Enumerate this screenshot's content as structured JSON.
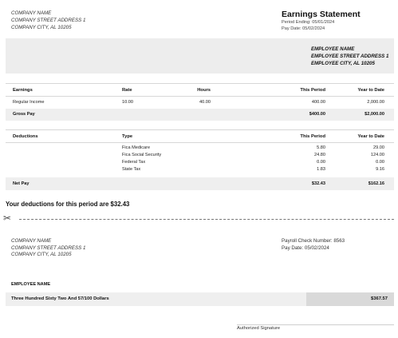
{
  "company": {
    "name": "COMPANY NAME",
    "address": "COMPANY STREET ADDRESS 1",
    "city": "COMPANY CITY, AL 10205"
  },
  "statement": {
    "title": "Earnings Statement",
    "period_ending": "Period Ending: 05/01/2024",
    "pay_date": "Pay Date: 05/02/2024"
  },
  "employee": {
    "name": "EMPLOYEE NAME",
    "address": "EMPLOYEE STREET ADDRESS 1",
    "city": "EMPLOYEE CITY, AL 10205"
  },
  "earnings": {
    "headers": {
      "label": "Earnings",
      "rate": "Rate",
      "hours": "Hours",
      "this_period": "This Period",
      "ytd": "Year to Date"
    },
    "rows": [
      {
        "label": "Regular Income",
        "rate": "10.00",
        "hours": "40.00",
        "this_period": "400.00",
        "ytd": "2,000.00"
      }
    ],
    "gross": {
      "label": "Gross Pay",
      "this_period": "$400.00",
      "ytd": "$2,000.00"
    }
  },
  "deductions": {
    "headers": {
      "label": "Deductions",
      "type": "Type",
      "this_period": "This Period",
      "ytd": "Year to Date"
    },
    "rows": [
      {
        "type": "Fica Medicare",
        "this_period": "5.80",
        "ytd": "29.00"
      },
      {
        "type": "Fica Social Security",
        "this_period": "24.80",
        "ytd": "124.00"
      },
      {
        "type": "Federal Tax",
        "this_period": "0.00",
        "ytd": "0.00"
      },
      {
        "type": "State Tax",
        "this_period": "1.83",
        "ytd": "9.16"
      }
    ],
    "net": {
      "label": "Net Pay",
      "this_period": "$32.43",
      "ytd": "$162.16"
    }
  },
  "note": "Your deductions for this period are $32.43",
  "icons": {
    "cut": "scissors-icon"
  },
  "check": {
    "company_name": "COMPANY NAME",
    "company_address": "COMPANY STREET ADDRESS 1",
    "company_city": "COMPANY CITY, AL 10205",
    "check_number": "Payroll Check Number: 8563",
    "pay_date": "Pay Date: 05/02/2024",
    "employee_name": "EMPLOYEE NAME",
    "amount_words": "Three Hundred Sixty Two And 57/100 Dollars",
    "amount": "$367.57",
    "signature_label": "Authorized Signature"
  }
}
